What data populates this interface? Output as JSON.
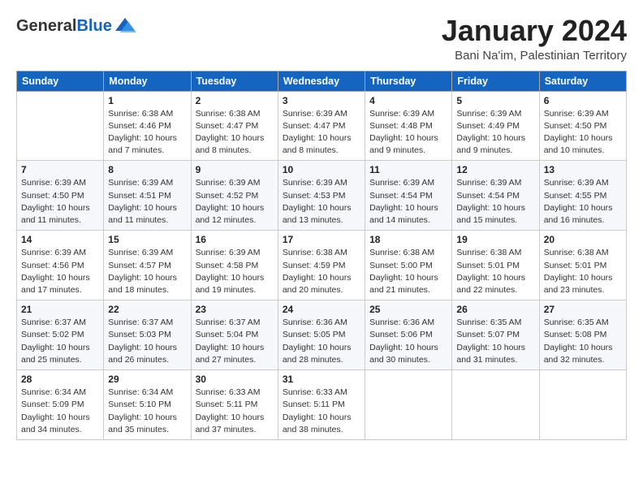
{
  "header": {
    "logo_general": "General",
    "logo_blue": "Blue",
    "title": "January 2024",
    "subtitle": "Bani Na'im, Palestinian Territory"
  },
  "calendar": {
    "days_of_week": [
      "Sunday",
      "Monday",
      "Tuesday",
      "Wednesday",
      "Thursday",
      "Friday",
      "Saturday"
    ],
    "weeks": [
      [
        {
          "day": "",
          "sunrise": "",
          "sunset": "",
          "daylight": ""
        },
        {
          "day": "1",
          "sunrise": "Sunrise: 6:38 AM",
          "sunset": "Sunset: 4:46 PM",
          "daylight": "Daylight: 10 hours and 7 minutes."
        },
        {
          "day": "2",
          "sunrise": "Sunrise: 6:38 AM",
          "sunset": "Sunset: 4:47 PM",
          "daylight": "Daylight: 10 hours and 8 minutes."
        },
        {
          "day": "3",
          "sunrise": "Sunrise: 6:39 AM",
          "sunset": "Sunset: 4:47 PM",
          "daylight": "Daylight: 10 hours and 8 minutes."
        },
        {
          "day": "4",
          "sunrise": "Sunrise: 6:39 AM",
          "sunset": "Sunset: 4:48 PM",
          "daylight": "Daylight: 10 hours and 9 minutes."
        },
        {
          "day": "5",
          "sunrise": "Sunrise: 6:39 AM",
          "sunset": "Sunset: 4:49 PM",
          "daylight": "Daylight: 10 hours and 9 minutes."
        },
        {
          "day": "6",
          "sunrise": "Sunrise: 6:39 AM",
          "sunset": "Sunset: 4:50 PM",
          "daylight": "Daylight: 10 hours and 10 minutes."
        }
      ],
      [
        {
          "day": "7",
          "sunrise": "Sunrise: 6:39 AM",
          "sunset": "Sunset: 4:50 PM",
          "daylight": "Daylight: 10 hours and 11 minutes."
        },
        {
          "day": "8",
          "sunrise": "Sunrise: 6:39 AM",
          "sunset": "Sunset: 4:51 PM",
          "daylight": "Daylight: 10 hours and 11 minutes."
        },
        {
          "day": "9",
          "sunrise": "Sunrise: 6:39 AM",
          "sunset": "Sunset: 4:52 PM",
          "daylight": "Daylight: 10 hours and 12 minutes."
        },
        {
          "day": "10",
          "sunrise": "Sunrise: 6:39 AM",
          "sunset": "Sunset: 4:53 PM",
          "daylight": "Daylight: 10 hours and 13 minutes."
        },
        {
          "day": "11",
          "sunrise": "Sunrise: 6:39 AM",
          "sunset": "Sunset: 4:54 PM",
          "daylight": "Daylight: 10 hours and 14 minutes."
        },
        {
          "day": "12",
          "sunrise": "Sunrise: 6:39 AM",
          "sunset": "Sunset: 4:54 PM",
          "daylight": "Daylight: 10 hours and 15 minutes."
        },
        {
          "day": "13",
          "sunrise": "Sunrise: 6:39 AM",
          "sunset": "Sunset: 4:55 PM",
          "daylight": "Daylight: 10 hours and 16 minutes."
        }
      ],
      [
        {
          "day": "14",
          "sunrise": "Sunrise: 6:39 AM",
          "sunset": "Sunset: 4:56 PM",
          "daylight": "Daylight: 10 hours and 17 minutes."
        },
        {
          "day": "15",
          "sunrise": "Sunrise: 6:39 AM",
          "sunset": "Sunset: 4:57 PM",
          "daylight": "Daylight: 10 hours and 18 minutes."
        },
        {
          "day": "16",
          "sunrise": "Sunrise: 6:39 AM",
          "sunset": "Sunset: 4:58 PM",
          "daylight": "Daylight: 10 hours and 19 minutes."
        },
        {
          "day": "17",
          "sunrise": "Sunrise: 6:38 AM",
          "sunset": "Sunset: 4:59 PM",
          "daylight": "Daylight: 10 hours and 20 minutes."
        },
        {
          "day": "18",
          "sunrise": "Sunrise: 6:38 AM",
          "sunset": "Sunset: 5:00 PM",
          "daylight": "Daylight: 10 hours and 21 minutes."
        },
        {
          "day": "19",
          "sunrise": "Sunrise: 6:38 AM",
          "sunset": "Sunset: 5:01 PM",
          "daylight": "Daylight: 10 hours and 22 minutes."
        },
        {
          "day": "20",
          "sunrise": "Sunrise: 6:38 AM",
          "sunset": "Sunset: 5:01 PM",
          "daylight": "Daylight: 10 hours and 23 minutes."
        }
      ],
      [
        {
          "day": "21",
          "sunrise": "Sunrise: 6:37 AM",
          "sunset": "Sunset: 5:02 PM",
          "daylight": "Daylight: 10 hours and 25 minutes."
        },
        {
          "day": "22",
          "sunrise": "Sunrise: 6:37 AM",
          "sunset": "Sunset: 5:03 PM",
          "daylight": "Daylight: 10 hours and 26 minutes."
        },
        {
          "day": "23",
          "sunrise": "Sunrise: 6:37 AM",
          "sunset": "Sunset: 5:04 PM",
          "daylight": "Daylight: 10 hours and 27 minutes."
        },
        {
          "day": "24",
          "sunrise": "Sunrise: 6:36 AM",
          "sunset": "Sunset: 5:05 PM",
          "daylight": "Daylight: 10 hours and 28 minutes."
        },
        {
          "day": "25",
          "sunrise": "Sunrise: 6:36 AM",
          "sunset": "Sunset: 5:06 PM",
          "daylight": "Daylight: 10 hours and 30 minutes."
        },
        {
          "day": "26",
          "sunrise": "Sunrise: 6:35 AM",
          "sunset": "Sunset: 5:07 PM",
          "daylight": "Daylight: 10 hours and 31 minutes."
        },
        {
          "day": "27",
          "sunrise": "Sunrise: 6:35 AM",
          "sunset": "Sunset: 5:08 PM",
          "daylight": "Daylight: 10 hours and 32 minutes."
        }
      ],
      [
        {
          "day": "28",
          "sunrise": "Sunrise: 6:34 AM",
          "sunset": "Sunset: 5:09 PM",
          "daylight": "Daylight: 10 hours and 34 minutes."
        },
        {
          "day": "29",
          "sunrise": "Sunrise: 6:34 AM",
          "sunset": "Sunset: 5:10 PM",
          "daylight": "Daylight: 10 hours and 35 minutes."
        },
        {
          "day": "30",
          "sunrise": "Sunrise: 6:33 AM",
          "sunset": "Sunset: 5:11 PM",
          "daylight": "Daylight: 10 hours and 37 minutes."
        },
        {
          "day": "31",
          "sunrise": "Sunrise: 6:33 AM",
          "sunset": "Sunset: 5:11 PM",
          "daylight": "Daylight: 10 hours and 38 minutes."
        },
        {
          "day": "",
          "sunrise": "",
          "sunset": "",
          "daylight": ""
        },
        {
          "day": "",
          "sunrise": "",
          "sunset": "",
          "daylight": ""
        },
        {
          "day": "",
          "sunrise": "",
          "sunset": "",
          "daylight": ""
        }
      ]
    ]
  }
}
